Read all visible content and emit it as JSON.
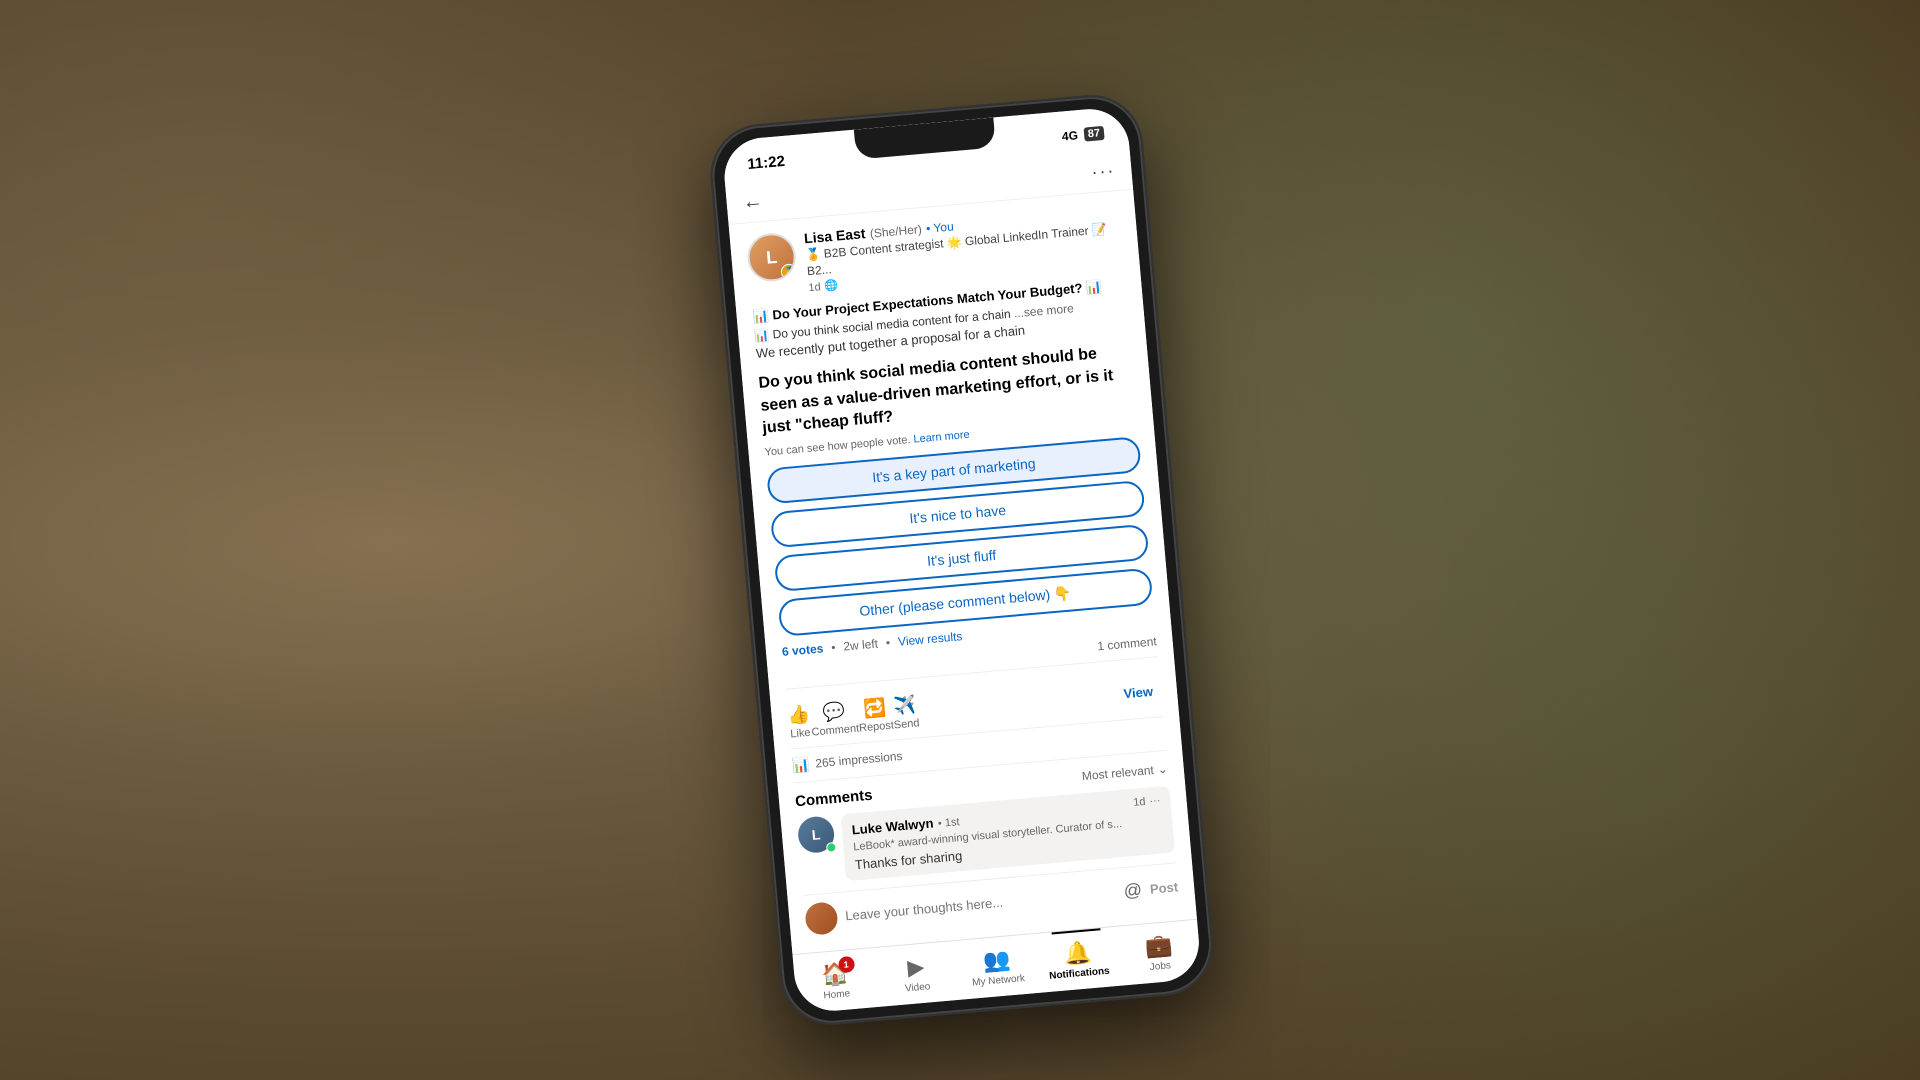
{
  "status_bar": {
    "time": "11:22",
    "signal": "4G",
    "battery": "87"
  },
  "top_nav": {
    "back": "←",
    "more": "···"
  },
  "author": {
    "name": "Lisa East",
    "pronouns": "(She/Her)",
    "connection": "• You",
    "title": "🏅 B2B Content strategist 🌟 Global LinkedIn Trainer 📝 B2...",
    "time": "1d",
    "visibility": "🌐"
  },
  "post": {
    "title": "📊 Do Your Project Expectations Match Your Budget? 📊",
    "subtitle": "📊 Do you think social media content for a chain",
    "see_more": "...see more",
    "body": "We recently put together a proposal for a chain"
  },
  "poll": {
    "question": "Do you think social media content should be seen as a value-driven marketing effort, or is it just \"cheap fluff?",
    "note": "You can see how people vote.",
    "learn_more": "Learn more",
    "options": [
      "It's a key part of marketing",
      "It's nice to have",
      "It's just fluff",
      "Other (please comment below) 👇"
    ],
    "votes": "6 votes",
    "time_left": "2w left",
    "view_results": "View results"
  },
  "post_footer": {
    "comment_count": "1 comment"
  },
  "actions": [
    {
      "icon": "👍",
      "label": "Like"
    },
    {
      "icon": "💬",
      "label": "Comment"
    },
    {
      "icon": "🔁",
      "label": "Repost"
    },
    {
      "icon": "✈️",
      "label": "Send"
    }
  ],
  "view_link": "View",
  "impressions": {
    "icon": "📊",
    "text": "265 impressions"
  },
  "comments": {
    "title": "Comments",
    "sort": "Most relevant",
    "items": [
      {
        "name": "Luke Walwyn",
        "connection": "• 1st",
        "time": "1d",
        "title": "LeBook* award-winning visual storyteller. Curator of s...",
        "text": "Thanks for sharing"
      }
    ]
  },
  "reply_input": {
    "placeholder": "Leave your thoughts here..."
  },
  "tab_bar": {
    "items": [
      {
        "icon": "🏠",
        "label": "Home",
        "badge": true,
        "active": false
      },
      {
        "icon": "▶️",
        "label": "Video",
        "active": false
      },
      {
        "icon": "👥",
        "label": "My Network",
        "active": false
      },
      {
        "icon": "🔔",
        "label": "Notifications",
        "active": true
      },
      {
        "icon": "💼",
        "label": "Jobs",
        "active": false
      }
    ]
  }
}
